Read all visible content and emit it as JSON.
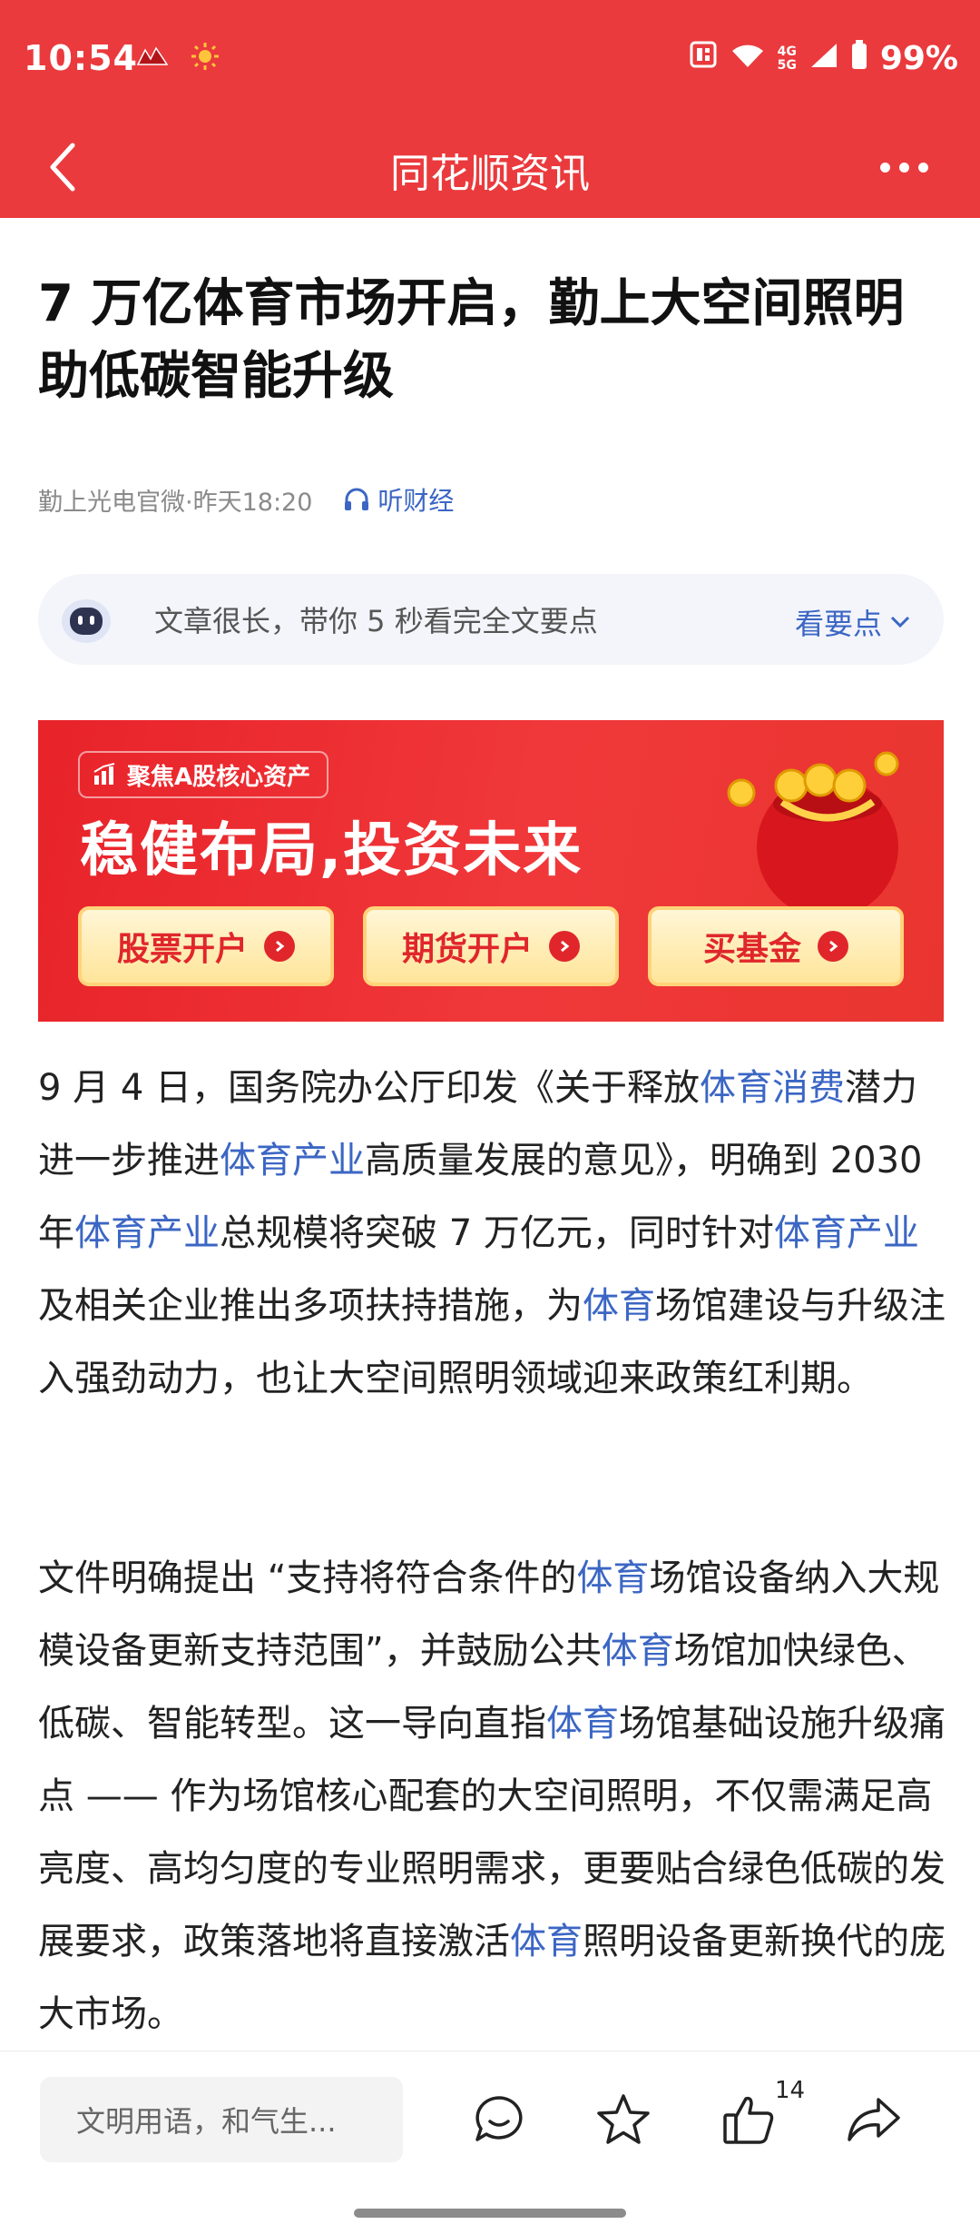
{
  "status_bar": {
    "time": "10:54",
    "battery": "99%",
    "network": [
      "4G",
      "5G"
    ]
  },
  "nav": {
    "title": "同花顺资讯"
  },
  "article": {
    "title": "7 万亿体育市场开启，勤上大空间照明助低碳智能升级",
    "source_time": "勤上光电官微·昨天18:20",
    "listen_label": "听财经"
  },
  "summary": {
    "text": "文章很长，带你 5 秒看完全文要点",
    "action": "看要点"
  },
  "banner": {
    "tag": "聚焦A股核心资产",
    "headline": "稳健布局,投资未来",
    "buttons": [
      "股票开户",
      "期货开户",
      "买基金"
    ]
  },
  "paragraph1": {
    "s1": "9 月 4 日，国务院办公厅印发《关于释放",
    "l1": "体育消费",
    "s2": "潜力进一步推进",
    "l2": "体育产业",
    "s3": "高质量发展的意见》，明确到 2030 年",
    "l3": "体育产业",
    "s4": "总规模将突破 7 万亿元，同时针对",
    "l4": "体育产业",
    "s5": "及相关企业推出多项扶持措施，为",
    "l5": "体育",
    "s6": "场馆建设与升级注入强劲动力，也让大空间照明领域迎来政策红利期。"
  },
  "paragraph2": {
    "s1": "文件明确提出 “支持将符合条件的",
    "l1": "体育",
    "s2": "场馆设备纳入大规模设备更新支持范围”，并鼓励公共",
    "l2": "体育",
    "s3": "场馆加快绿色、低碳、智能转型。这一导向直指",
    "l3": "体育",
    "s4": "场馆基础设施升级痛点 —— 作为场馆核心配套的大空间照明，不仅需满足高亮度、高均匀度的专业照明需求，更要贴合绿色低碳的发展要求，政策落地将直接激活",
    "l4": "体育",
    "s5": "照明设备更新换代的庞大市场。"
  },
  "bottom_bar": {
    "comment_placeholder": "文明用语，和气生...",
    "like_count": "14"
  },
  "colors": {
    "header_red": "#ea3a3d",
    "link_blue": "#3b66c4"
  }
}
